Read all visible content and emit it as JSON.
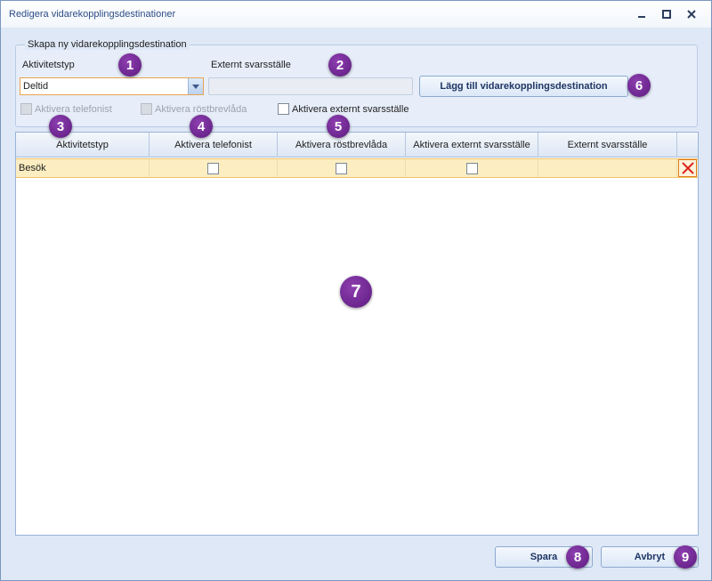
{
  "window": {
    "title": "Redigera vidarekopplingsdestinationer",
    "controls": [
      "minimize-icon",
      "restore-icon",
      "close-icon"
    ]
  },
  "create_group": {
    "title": "Skapa ny vidarekopplingsdestination",
    "activity_type_label": "Aktivitetstyp",
    "activity_type_value": "Deltid",
    "external_label": "Externt svarsställe",
    "external_value": "",
    "add_button_label": "Lägg till vidarekopplingsdestination",
    "checkboxes": [
      {
        "label": "Aktivera telefonist",
        "checked": false,
        "enabled": false
      },
      {
        "label": "Aktivera röstbrevlåda",
        "checked": false,
        "enabled": false
      },
      {
        "label": "Aktivera externt svarsställe",
        "checked": false,
        "enabled": true
      }
    ]
  },
  "grid": {
    "columns": [
      "Aktivitetstyp",
      "Aktivera telefonist",
      "Aktivera röstbrevlåda",
      "Aktivera externt svarsställe",
      "Externt svarsställe"
    ],
    "rows": [
      {
        "activity_type": "Besök",
        "telefonist": false,
        "rostbrevlada": false,
        "externt": false,
        "externt_svarsstalle": ""
      }
    ]
  },
  "footer": {
    "save_label": "Spara",
    "cancel_label": "Avbryt"
  },
  "markers": [
    "1",
    "2",
    "3",
    "4",
    "5",
    "6",
    "7",
    "8",
    "9"
  ],
  "colors": {
    "accent_selection": "#fdeec2",
    "marker": "#6a2590",
    "delete": "#d9261c"
  }
}
